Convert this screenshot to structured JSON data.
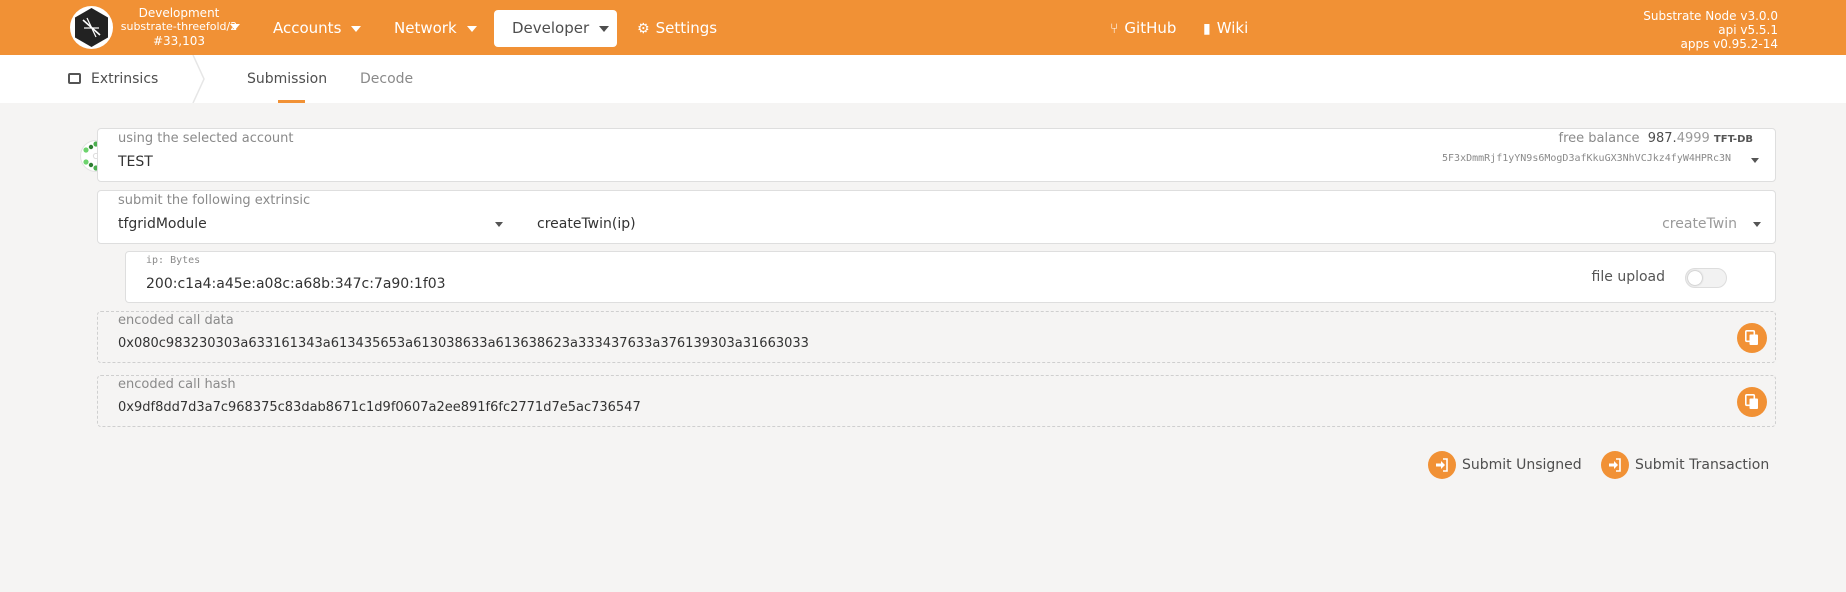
{
  "chain": {
    "network": "Development",
    "name": "substrate-threefold/2",
    "block": "#33,103"
  },
  "nav": {
    "accounts": "Accounts",
    "network": "Network",
    "developer": "Developer",
    "settings": "Settings",
    "github": "GitHub",
    "wiki": "Wiki"
  },
  "version": {
    "node": "Substrate Node v3.0.0",
    "api": "api v5.5.1",
    "apps": "apps v0.95.2-14"
  },
  "subnav": {
    "section": "Extrinsics",
    "tabs": [
      "Submission",
      "Decode"
    ],
    "active_tab": "Submission"
  },
  "account": {
    "label": "using the selected account",
    "name": "TEST",
    "free_balance_label": "free balance",
    "balance_int": "987.",
    "balance_dec": "4999",
    "balance_unit": "TFT-DB",
    "address": "5F3xDmmRjf1yYN9s6MogD3afKkuGX3NhVCJkz4fyW4HPRc3N"
  },
  "extrinsic": {
    "label": "submit the following extrinsic",
    "module": "tfgridModule",
    "call_signature": "createTwin(ip)",
    "call_selected": "createTwin"
  },
  "param": {
    "label": "ip: Bytes",
    "value": "200:c1a4:a45e:a08c:a68b:347c:7a90:1f03",
    "file_upload_label": "file upload",
    "file_upload_enabled": false
  },
  "encoded_call_data": {
    "label": "encoded call data",
    "value": "0x080c983230303a633161343a613435653a613038633a613638623a333437633a376139303a31663033"
  },
  "encoded_call_hash": {
    "label": "encoded call hash",
    "value": "0x9df8dd7d3a7c968375c83dab8671c1d9f0607a2ee891f6fc2771d7e5ac736547"
  },
  "actions": {
    "submit_unsigned": "Submit Unsigned",
    "submit_transaction": "Submit Transaction"
  },
  "colors": {
    "accent": "#f19135",
    "background": "#f5f4f3"
  }
}
